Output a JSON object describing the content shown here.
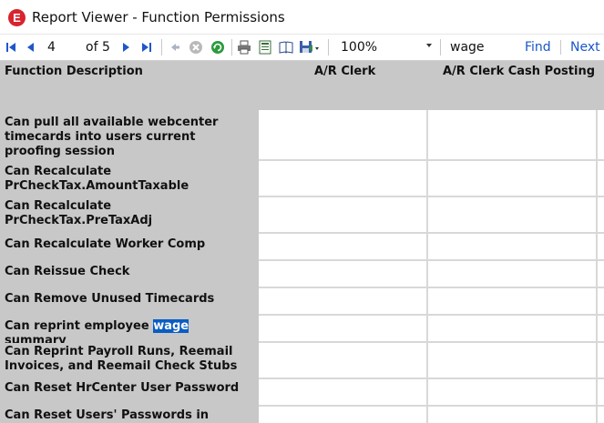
{
  "window": {
    "title": "Report Viewer - Function Permissions",
    "app_icon_letter": "E"
  },
  "toolbar": {
    "current_page": "4",
    "of_label": "of 5",
    "zoom": "100%",
    "search_text": "wage",
    "find_label": "Find",
    "next_label": "Next"
  },
  "report": {
    "columns": [
      "Function Description",
      "A/R Clerk",
      "A/R Clerk Cash Posting"
    ],
    "rows": [
      {
        "pre": "Can pull all available webcenter timecards into users current proofing session",
        "hl": "",
        "post": ""
      },
      {
        "pre": "Can Recalculate PrCheckTax.AmountTaxable",
        "hl": "",
        "post": ""
      },
      {
        "pre": "Can Recalculate PrCheckTax.PreTaxAdj",
        "hl": "",
        "post": ""
      },
      {
        "pre": "Can Recalculate Worker Comp",
        "hl": "",
        "post": ""
      },
      {
        "pre": "Can Reissue Check",
        "hl": "",
        "post": ""
      },
      {
        "pre": "Can Remove Unused Timecards",
        "hl": "",
        "post": ""
      },
      {
        "pre": "Can reprint employee ",
        "hl": "wage",
        "post": " summary"
      },
      {
        "pre": "Can Reprint Payroll Runs, Reemail Invoices, and Reemail Check Stubs",
        "hl": "",
        "post": ""
      },
      {
        "pre": "Can Reset HrCenter User Password",
        "hl": "",
        "post": ""
      },
      {
        "pre": "Can Reset Users' Passwords in Applicant",
        "hl": "",
        "post": ""
      }
    ]
  },
  "colors": {
    "header_bg": "#c8c8c8",
    "highlight": "#0a5dc2",
    "link": "#1a57c8",
    "brand": "#d9232e"
  }
}
